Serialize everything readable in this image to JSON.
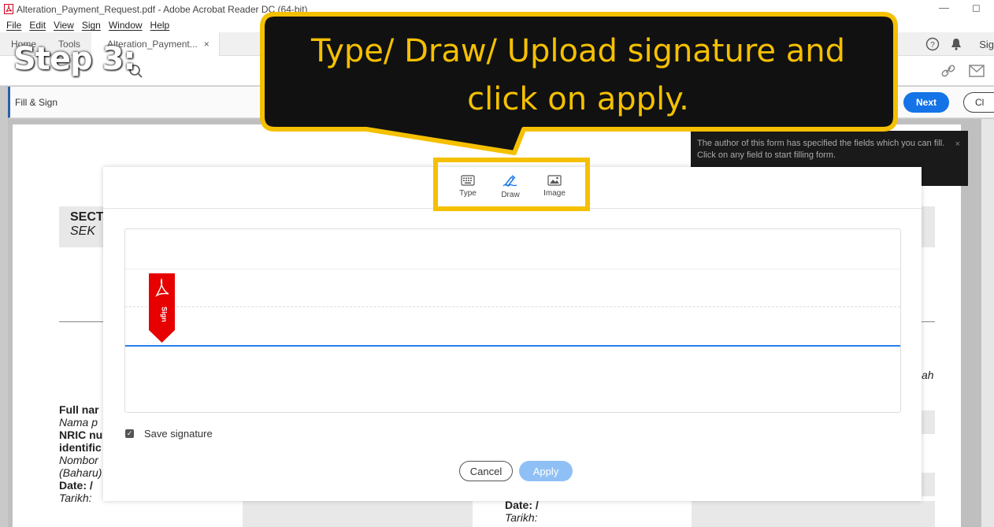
{
  "window": {
    "title": "Alteration_Payment_Request.pdf - Adobe Acrobat Reader DC (64-bit)",
    "minimize_glyph": "—",
    "restore_glyph": "◻"
  },
  "menu": [
    "File",
    "Edit",
    "View",
    "Sign",
    "Window",
    "Help"
  ],
  "tabs": {
    "home": "Home",
    "tools": "Tools",
    "document": "Alteration_Payment...",
    "close_glyph": "×",
    "sign_in": "Sig"
  },
  "fill_sign": {
    "title": "Fill & Sign",
    "next_label": "Next",
    "close_label": "Cl"
  },
  "info_tip": {
    "text": "The author of this form has specified the fields which you can fill. Click on any field to start filling form.",
    "close_glyph": "×"
  },
  "document": {
    "section_l1": "SECT",
    "section_l2": "SEK",
    "right_partial": "ah",
    "labels": [
      {
        "text": "Full nar",
        "style": "b"
      },
      {
        "text": "Nama p",
        "style": "i"
      },
      {
        "text": "NRIC nu",
        "style": "b"
      },
      {
        "text": "identific",
        "style": "b"
      },
      {
        "text": "Nombor",
        "style": "i"
      },
      {
        "text": "(Baharu)",
        "style": "i"
      },
      {
        "text": "Date: /",
        "style": "b"
      },
      {
        "text": "Tarikh:",
        "style": "i"
      }
    ],
    "date_right": {
      "l1": "Date: /",
      "l2": "Tarikh:"
    }
  },
  "signature_dialog": {
    "tabs": [
      {
        "label": "Type",
        "icon": "keyboard-icon"
      },
      {
        "label": "Draw",
        "icon": "pen-draw-icon"
      },
      {
        "label": "Image",
        "icon": "image-icon"
      }
    ],
    "active_tab": "Draw",
    "sign_flag_text": "Sign",
    "save_signature_label": "Save signature",
    "save_signature_checked": true,
    "cancel_label": "Cancel",
    "apply_label": "Apply"
  },
  "annotation": {
    "step": "Step 3:",
    "callout_line1": "Type/ Draw/ Upload signature and",
    "callout_line2": "click on apply.",
    "highlight_color": "#f5c000"
  }
}
